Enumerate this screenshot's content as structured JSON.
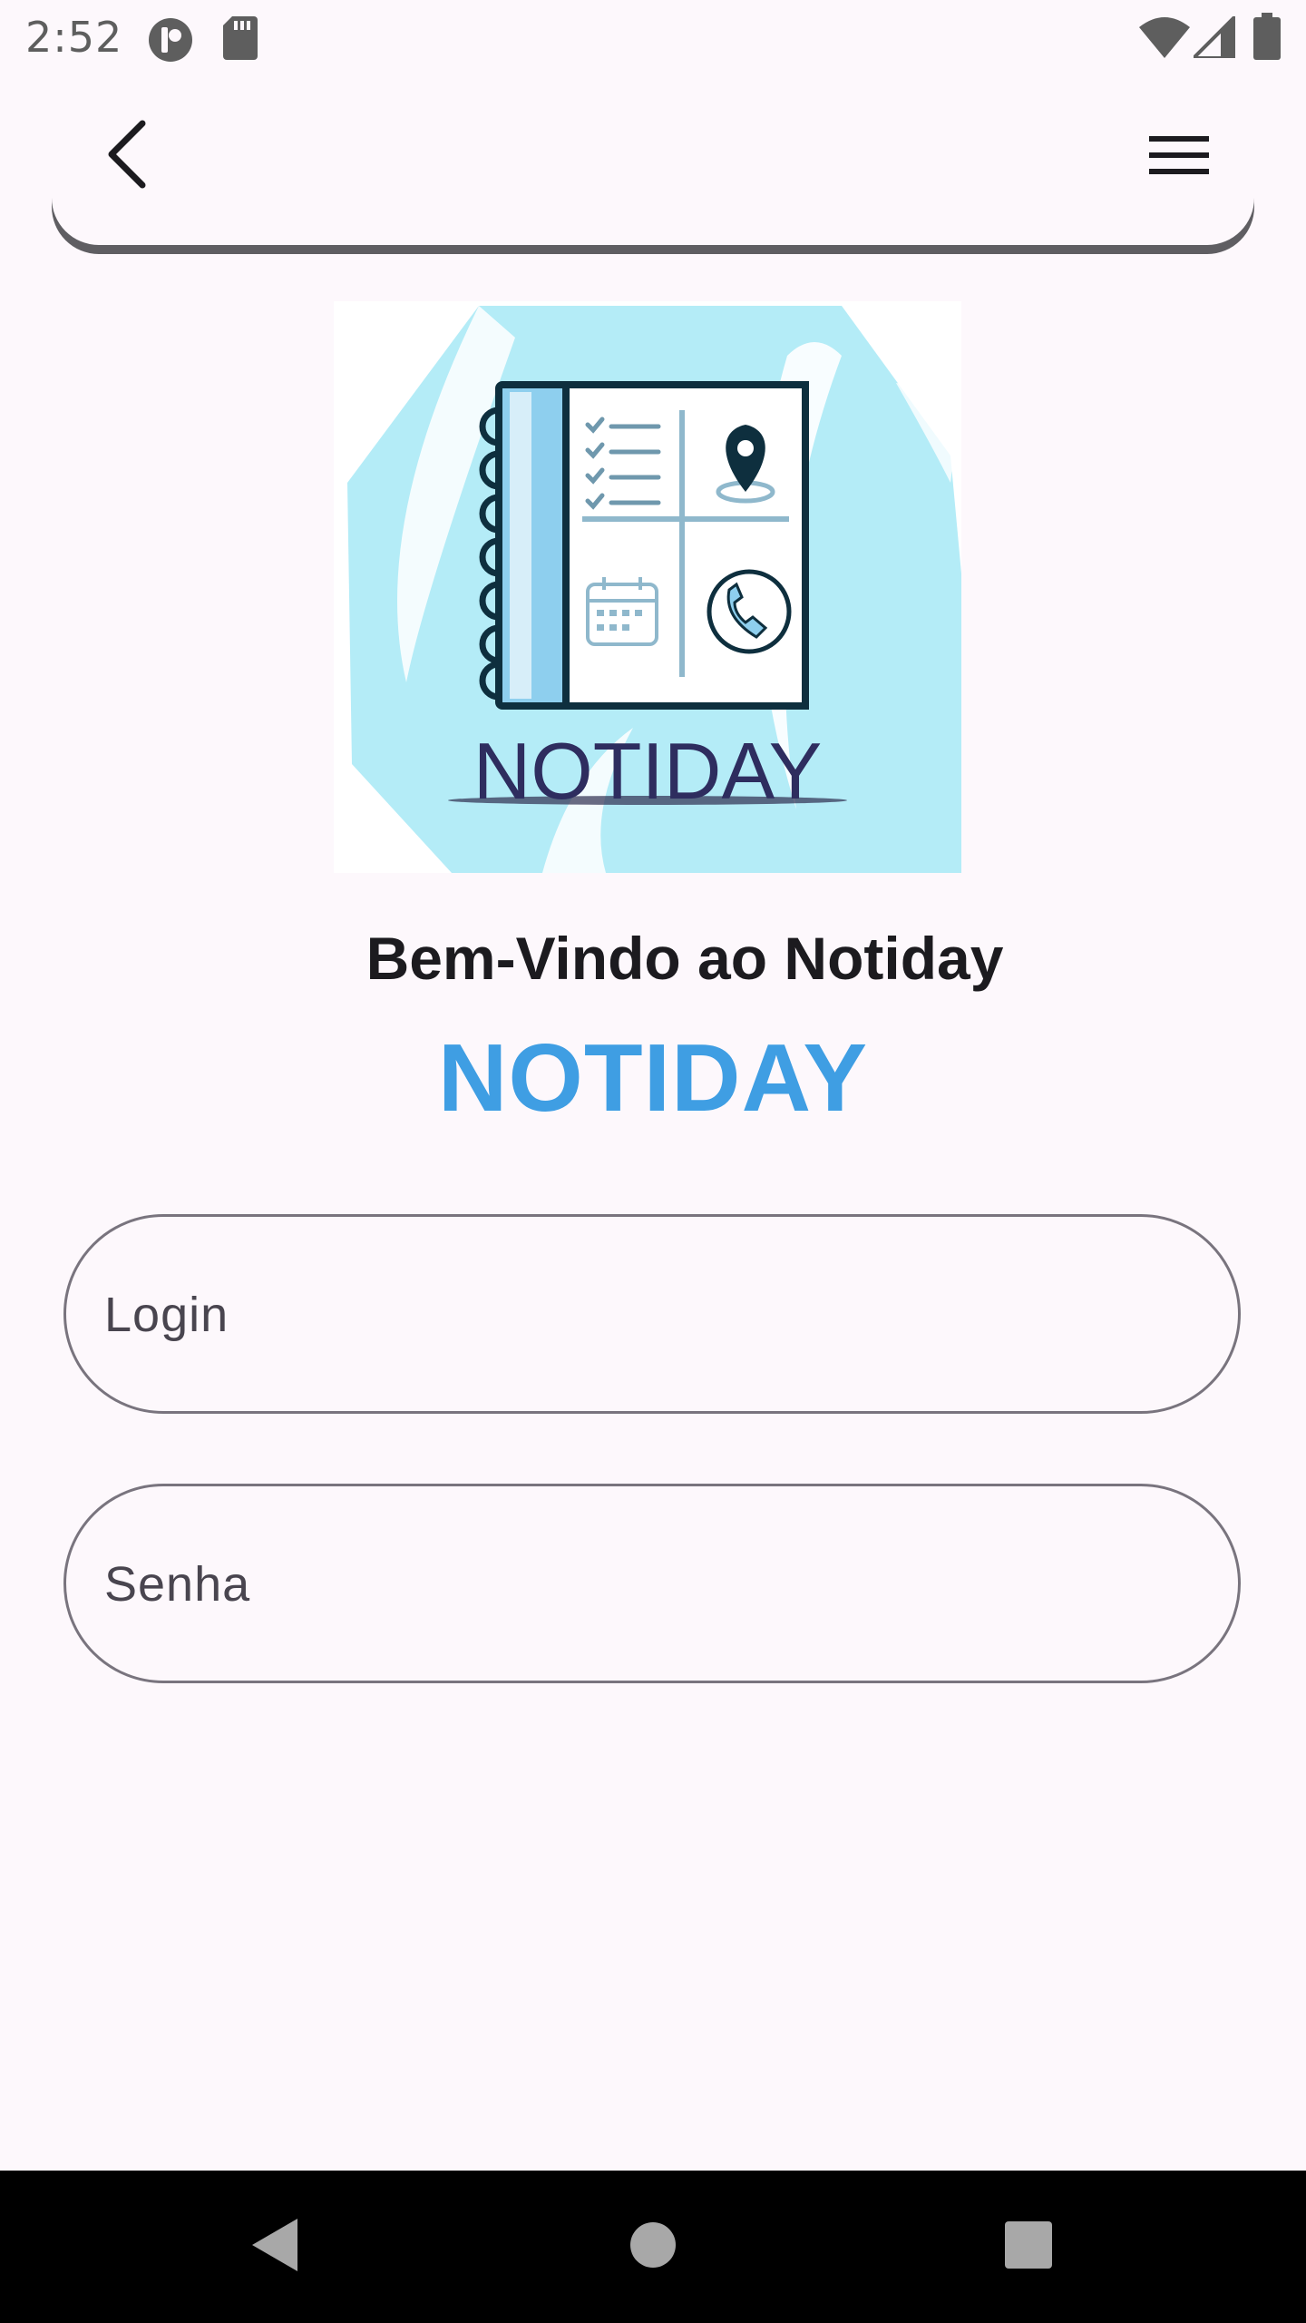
{
  "status_bar": {
    "time": "2:52",
    "icons": [
      "app-notification-icon",
      "sd-card-icon",
      "wifi-icon",
      "cell-signal-icon",
      "battery-icon"
    ]
  },
  "app_bar": {
    "back_icon": "back-arrow-icon",
    "menu_icon": "hamburger-menu-icon"
  },
  "logo": {
    "text": "NOTIDAY"
  },
  "welcome": {
    "heading": "Bem-Vindo ao Notiday",
    "brand": "NOTIDAY"
  },
  "form": {
    "login_placeholder": "Login",
    "senha_placeholder": "Senha"
  },
  "nav_bar": {
    "back": "nav-back-icon",
    "home": "nav-home-icon",
    "recents": "nav-recents-icon"
  },
  "colors": {
    "background": "#fdf8fc",
    "brand_blue": "#3f9ee3",
    "outline": "#79747e",
    "logo_cyan": "#b4ecf7"
  }
}
